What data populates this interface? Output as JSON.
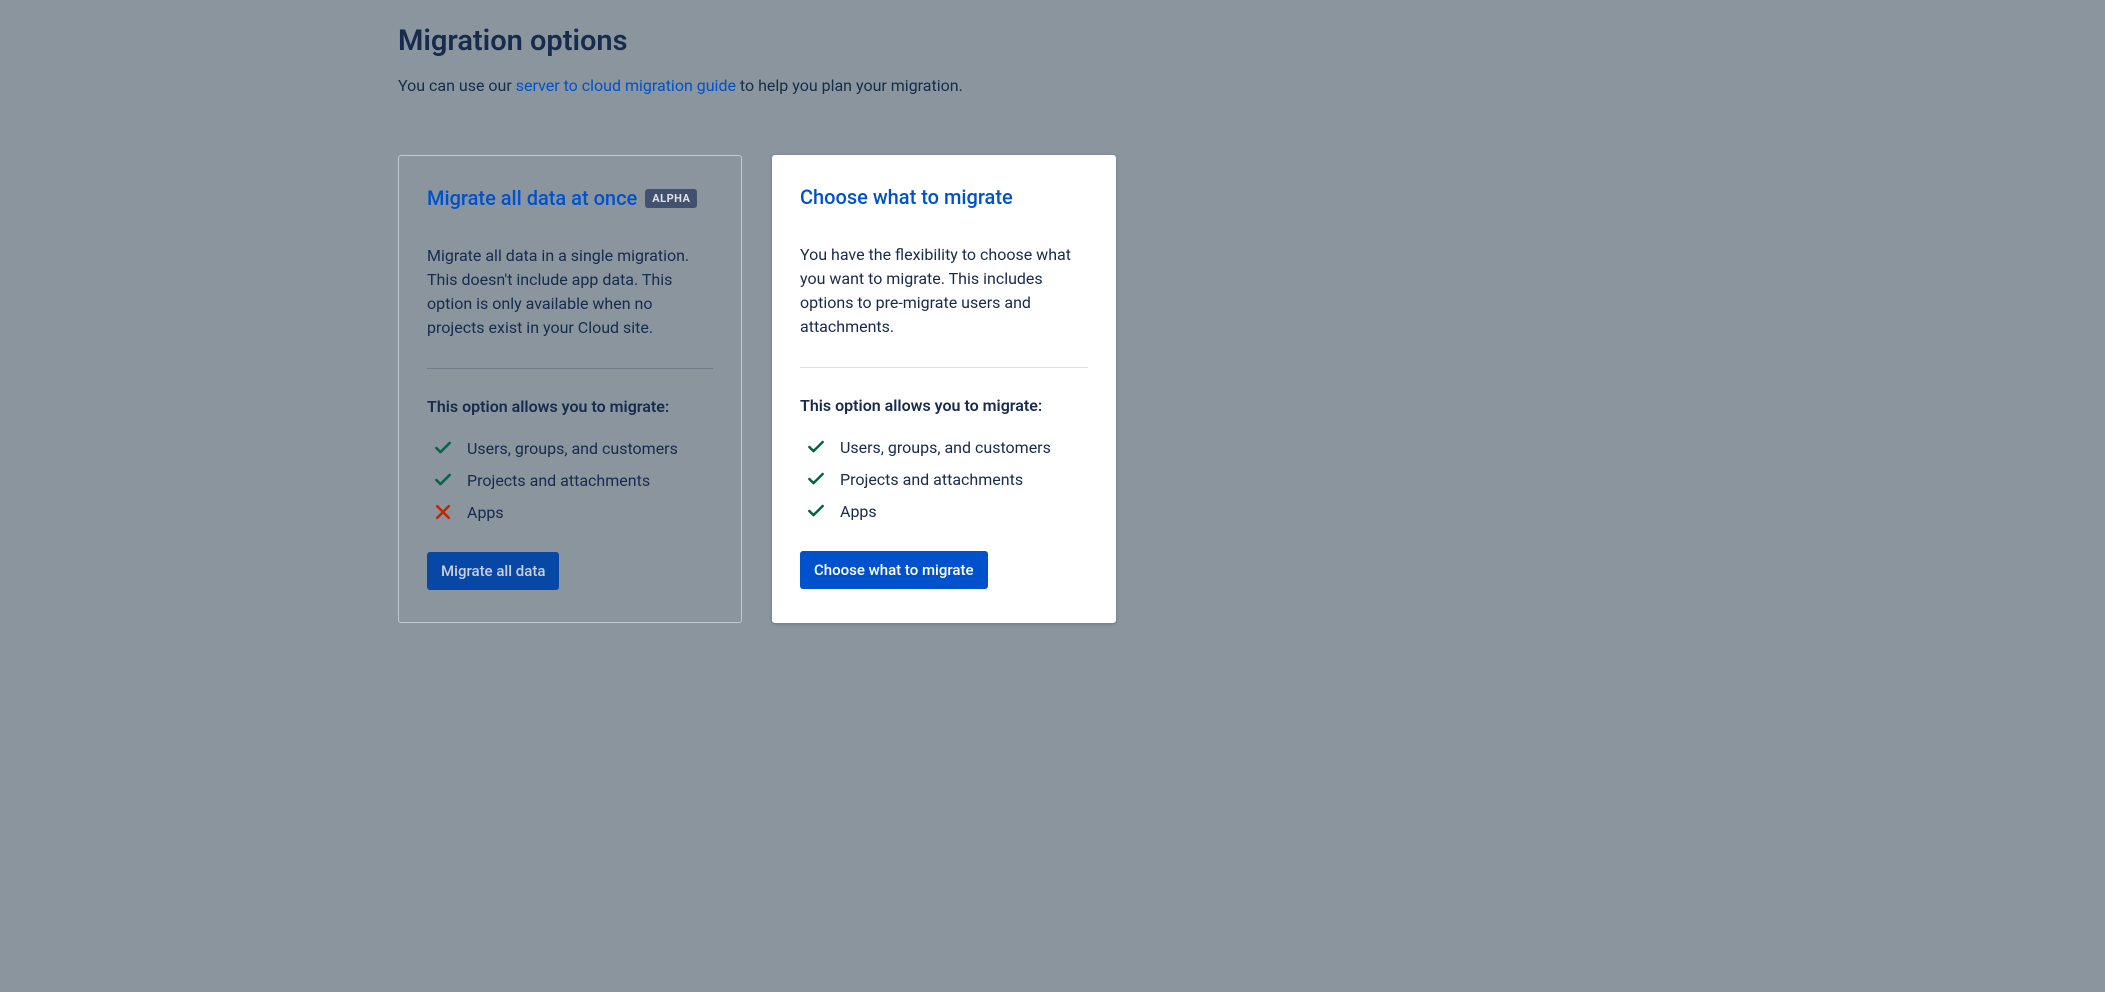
{
  "page": {
    "title": "Migration options",
    "intro_prefix": "You can use our ",
    "intro_link": "server to cloud migration guide",
    "intro_suffix": " to help you plan your migration."
  },
  "cards": {
    "migrate_all": {
      "title": "Migrate all data at once",
      "badge": "ALPHA",
      "description": "Migrate all data in a single migration. This doesn't include app data. This option is only available when no projects exist in your Cloud site.",
      "allows_heading": "This option allows you to migrate:",
      "features": [
        {
          "label": "Users, groups, and customers",
          "ok": true
        },
        {
          "label": "Projects and attachments",
          "ok": true
        },
        {
          "label": "Apps",
          "ok": false
        }
      ],
      "button": "Migrate all data"
    },
    "choose": {
      "title": "Choose what to migrate",
      "description": "You have the flexibility to choose what you want to migrate. This includes options to pre-migrate users and attachments.",
      "allows_heading": "This option allows you to migrate:",
      "features": [
        {
          "label": "Users, groups, and customers",
          "ok": true
        },
        {
          "label": "Projects and attachments",
          "ok": true
        },
        {
          "label": "Apps",
          "ok": true
        }
      ],
      "button": "Choose what to migrate"
    }
  }
}
